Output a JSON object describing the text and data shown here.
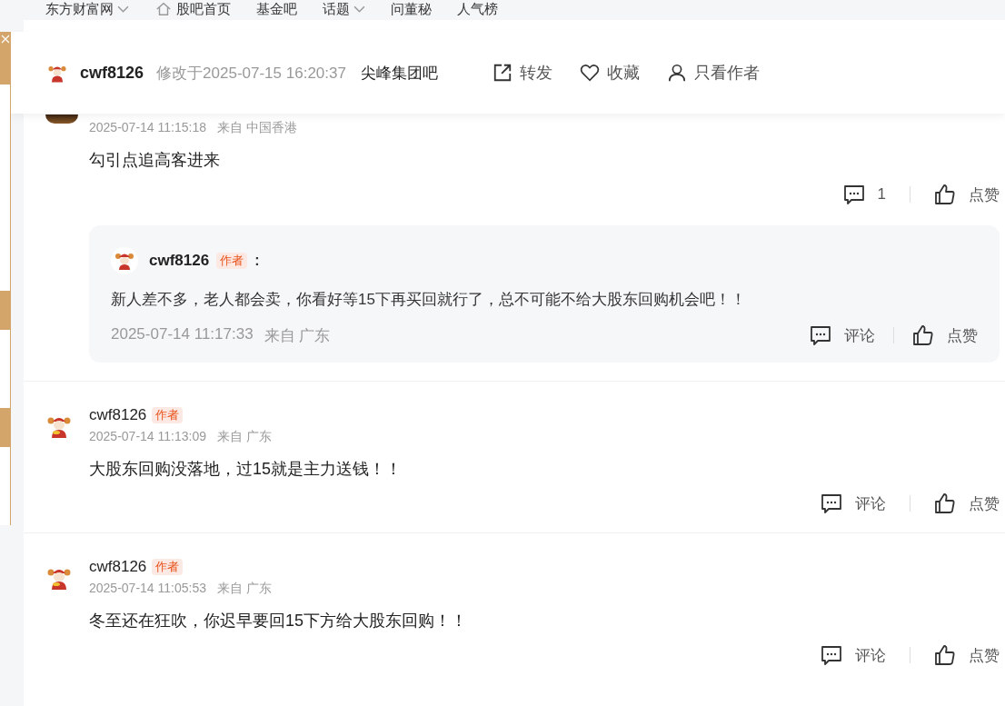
{
  "top_nav": [
    {
      "label": "东方财富网",
      "kind": "dropdown"
    },
    {
      "label": "股吧首页",
      "kind": "home"
    },
    {
      "label": "基金吧",
      "kind": "plain"
    },
    {
      "label": "话题",
      "kind": "dropdown"
    },
    {
      "label": "问董秘",
      "kind": "plain"
    },
    {
      "label": "人气榜",
      "kind": "plain"
    }
  ],
  "post_header": {
    "author": "cwf8126",
    "modified": "修改于2025-07-15 16:20:37",
    "bar": "尖峰集团吧",
    "actions": [
      {
        "kind": "share",
        "label": "转发"
      },
      {
        "kind": "favorite",
        "label": "收藏"
      },
      {
        "kind": "author_only",
        "label": "只看作者"
      }
    ]
  },
  "comments": [
    {
      "time": "2025-07-14 11:15:18",
      "location": "来自 中国香港",
      "text": "勾引点追高客进来",
      "actions": [
        {
          "kind": "comment",
          "label": "1"
        },
        {
          "kind": "like",
          "label": "点赞"
        }
      ],
      "replies": [
        {
          "author": "cwf8126",
          "badge": "作者",
          "colon": ":",
          "text": "新人差不多，老人都会卖，你看好等15下再买回就行了，总不可能不给大股东回购机会吧！！",
          "time": "2025-07-14 11:17:33",
          "location": "来自 广东",
          "actions": [
            {
              "kind": "comment",
              "label": "评论"
            },
            {
              "kind": "like",
              "label": "点赞"
            }
          ]
        }
      ]
    },
    {
      "author": "cwf8126",
      "badge": "作者",
      "time": "2025-07-14 11:13:09",
      "location": "来自 广东",
      "text": "大股东回购没落地，过15就是主力送钱！！",
      "actions": [
        {
          "kind": "comment",
          "label": "评论"
        },
        {
          "kind": "like",
          "label": "点赞"
        }
      ]
    },
    {
      "author": "cwf8126",
      "badge": "作者",
      "time": "2025-07-14 11:05:53",
      "location": "来自 广东",
      "text": "冬至还在狂吹，你迟早要回15下方给大股东回购！！",
      "actions": [
        {
          "kind": "comment",
          "label": "评论"
        },
        {
          "kind": "like",
          "label": "点赞"
        }
      ]
    }
  ]
}
